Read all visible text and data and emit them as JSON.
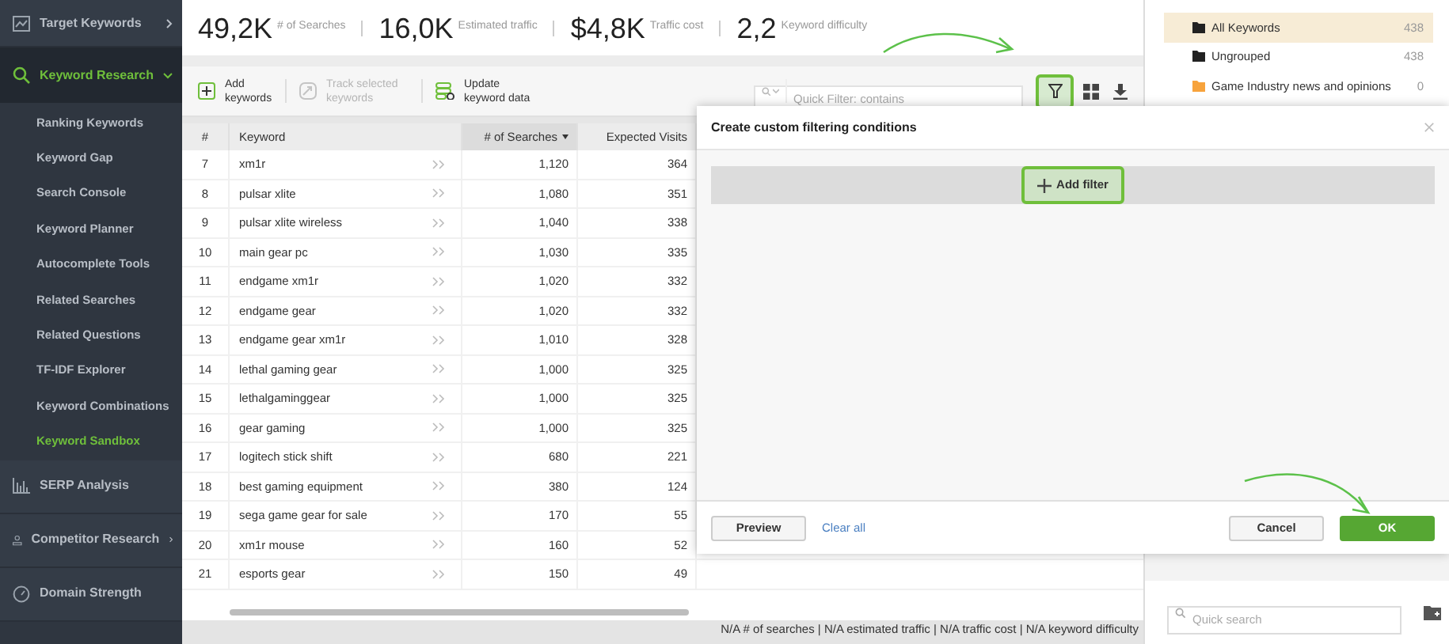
{
  "sidebar": {
    "items": [
      {
        "label": "Target Keywords",
        "selected": false,
        "expanded": false
      },
      {
        "label": "Keyword Research",
        "selected": true,
        "expanded": true,
        "children": [
          {
            "label": "Ranking Keywords",
            "selected": false
          },
          {
            "label": "Keyword Gap",
            "selected": false
          },
          {
            "label": "Search Console",
            "selected": false
          },
          {
            "label": "Keyword Planner",
            "selected": false
          },
          {
            "label": "Autocomplete Tools",
            "selected": false
          },
          {
            "label": "Related Searches",
            "selected": false
          },
          {
            "label": "Related Questions",
            "selected": false
          },
          {
            "label": "TF-IDF Explorer",
            "selected": false
          },
          {
            "label": "Keyword Combinations",
            "selected": false
          },
          {
            "label": "Keyword Sandbox",
            "selected": true
          }
        ]
      },
      {
        "label": "SERP Analysis",
        "selected": false
      },
      {
        "label": "Competitor Research",
        "selected": false,
        "expanded": false
      },
      {
        "label": "Domain Strength",
        "selected": false
      }
    ]
  },
  "stats": [
    {
      "value": "49,2K",
      "label": "# of Searches"
    },
    {
      "value": "16,0K",
      "label": "Estimated traffic"
    },
    {
      "value": "$4,8K",
      "label": "Traffic cost"
    },
    {
      "value": "2,2",
      "label": "Keyword difficulty"
    }
  ],
  "toolbar": {
    "actions": [
      {
        "label": "Add keywords",
        "disabled": false
      },
      {
        "label": "Track selected keywords",
        "disabled": true
      },
      {
        "label": "Update keyword data",
        "disabled": false
      }
    ],
    "quick_filter": {
      "placeholder": "Quick Filter: contains"
    },
    "filter_button": {
      "highlighted": true
    }
  },
  "table": {
    "columns": [
      {
        "label": "#",
        "sorted": false
      },
      {
        "label": "Keyword",
        "sorted": false
      },
      {
        "label": "# of Searches",
        "sorted": true
      },
      {
        "label": "Expected Visits",
        "sorted": false
      }
    ],
    "rows": [
      {
        "n": "7",
        "keyword": "xm1r",
        "searches": "1,120",
        "visits": "364"
      },
      {
        "n": "8",
        "keyword": "pulsar xlite",
        "searches": "1,080",
        "visits": "351"
      },
      {
        "n": "9",
        "keyword": "pulsar xlite wireless",
        "searches": "1,040",
        "visits": "338"
      },
      {
        "n": "10",
        "keyword": "main gear pc",
        "searches": "1,030",
        "visits": "335"
      },
      {
        "n": "11",
        "keyword": "endgame xm1r",
        "searches": "1,020",
        "visits": "332"
      },
      {
        "n": "12",
        "keyword": "endgame gear",
        "searches": "1,020",
        "visits": "332"
      },
      {
        "n": "13",
        "keyword": "endgame gear xm1r",
        "searches": "1,010",
        "visits": "328"
      },
      {
        "n": "14",
        "keyword": "lethal gaming gear",
        "searches": "1,000",
        "visits": "325"
      },
      {
        "n": "15",
        "keyword": "lethalgaminggear",
        "searches": "1,000",
        "visits": "325"
      },
      {
        "n": "16",
        "keyword": "gear gaming",
        "searches": "1,000",
        "visits": "325"
      },
      {
        "n": "17",
        "keyword": "logitech stick shift",
        "searches": "680",
        "visits": "221"
      },
      {
        "n": "18",
        "keyword": "best gaming equipment",
        "searches": "380",
        "visits": "124"
      },
      {
        "n": "19",
        "keyword": "sega game gear for sale",
        "searches": "170",
        "visits": "55"
      },
      {
        "n": "20",
        "keyword": "xm1r mouse",
        "searches": "160",
        "visits": "52"
      },
      {
        "n": "21",
        "keyword": "esports gear",
        "searches": "150",
        "visits": "49"
      }
    ]
  },
  "summary": "N/A # of searches | N/A estimated traffic | N/A traffic cost | N/A keyword difficulty",
  "groups": [
    {
      "label": "All Keywords",
      "count": "438",
      "selected": true,
      "color": "#222222"
    },
    {
      "label": "Ungrouped",
      "count": "438",
      "selected": false,
      "color": "#222222"
    },
    {
      "label": "Game Industry news and opinions",
      "count": "0",
      "selected": false,
      "color": "#f7a33c"
    }
  ],
  "group_search": {
    "placeholder": "Quick search"
  },
  "dialog": {
    "title": "Create custom filtering conditions",
    "add_filter": {
      "label": "Add filter",
      "highlighted": true
    },
    "buttons": [
      {
        "label": "Preview",
        "kind": "secondary"
      },
      {
        "label": "Clear all",
        "kind": "link"
      },
      {
        "label": "Cancel",
        "kind": "secondary"
      },
      {
        "label": "OK",
        "kind": "primary"
      }
    ]
  }
}
